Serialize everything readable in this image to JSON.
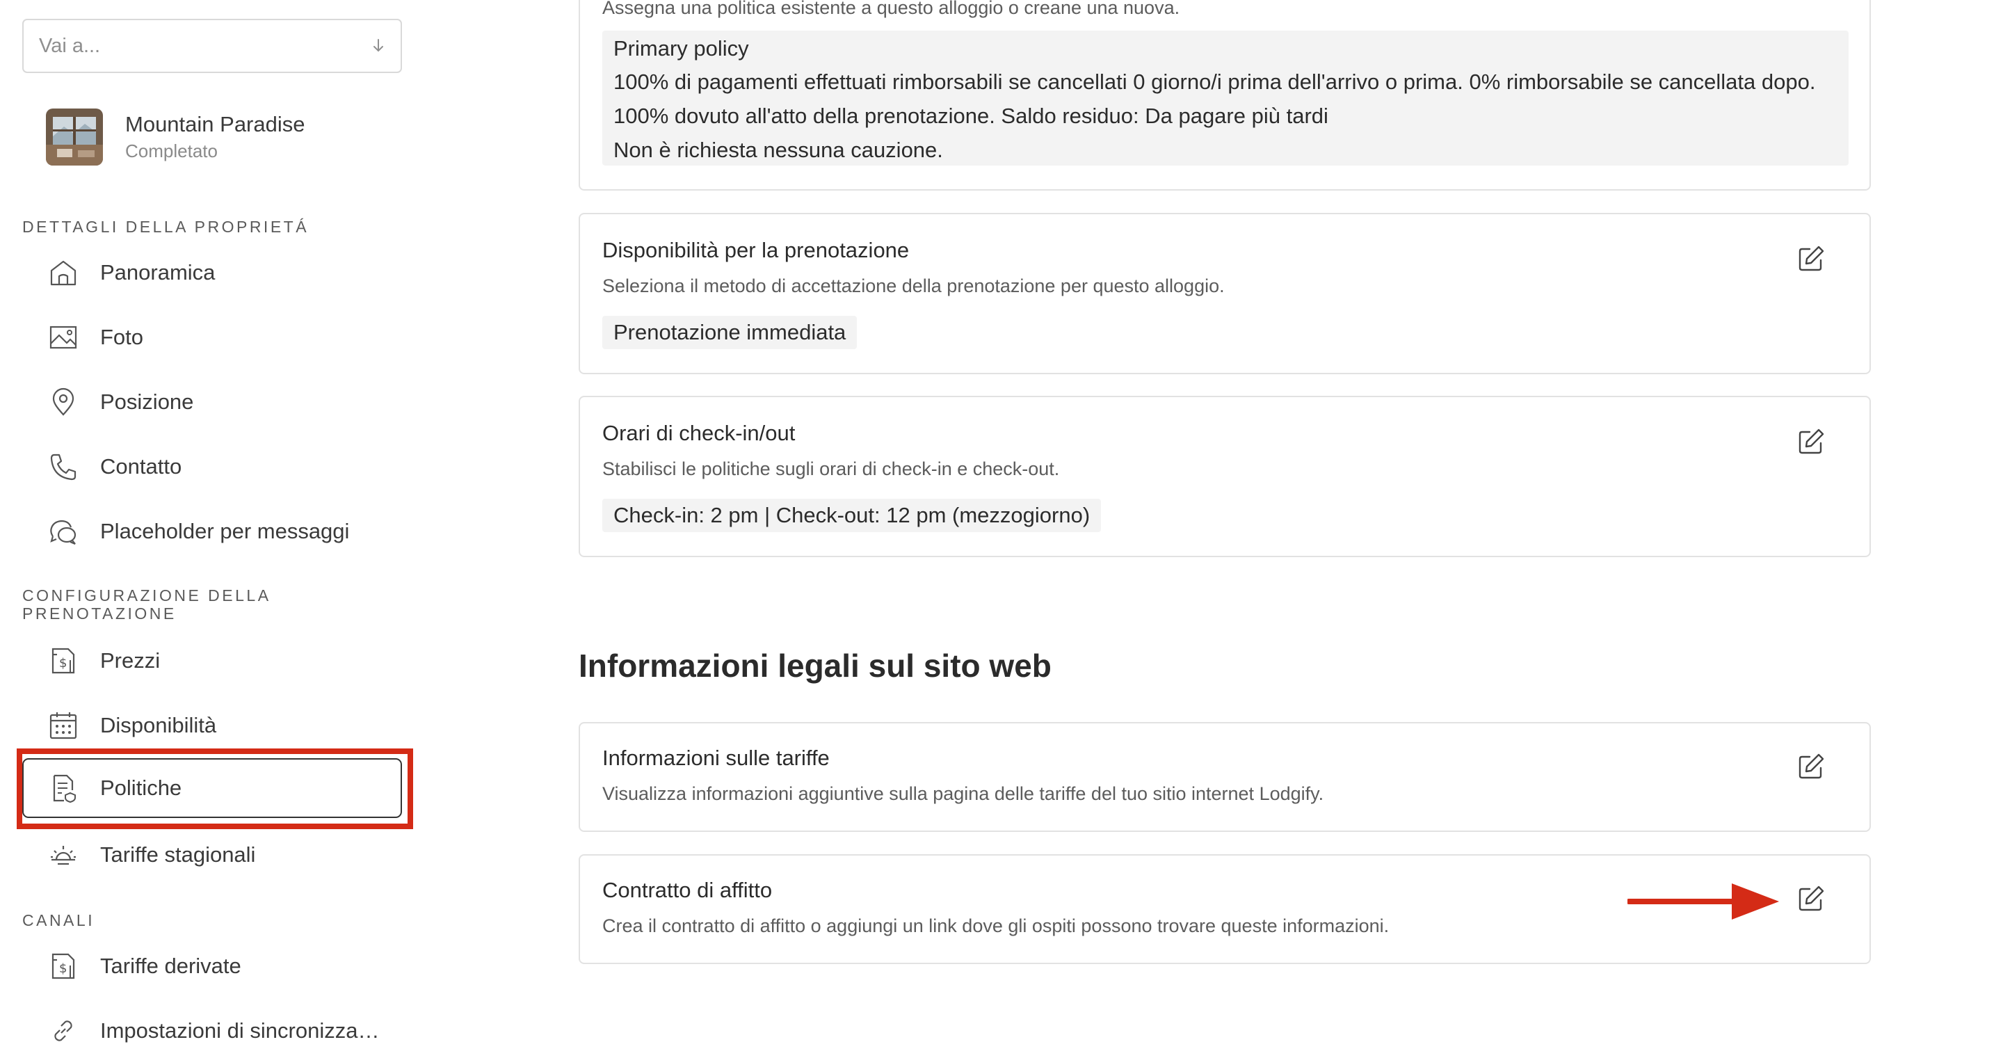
{
  "sidebar": {
    "goto": {
      "placeholder": "Vai a...",
      "icon": "arrow-down-icon"
    },
    "property": {
      "name": "Mountain Paradise",
      "status": "Completato"
    },
    "sections": [
      {
        "title": "DETTAGLI DELLA PROPRIETÁ",
        "items": [
          {
            "label": "Panoramica",
            "icon": "home-icon"
          },
          {
            "label": "Foto",
            "icon": "image-icon"
          },
          {
            "label": "Posizione",
            "icon": "location-pin-icon"
          },
          {
            "label": "Contatto",
            "icon": "phone-icon"
          },
          {
            "label": "Placeholder per messaggi",
            "icon": "chat-bubbles-icon"
          }
        ]
      },
      {
        "title": "CONFIGURAZIONE DELLA PRENOTAZIONE",
        "items": [
          {
            "label": "Prezzi",
            "icon": "price-tag-icon"
          },
          {
            "label": "Disponibilità",
            "icon": "calendar-icon"
          },
          {
            "label": "Politiche",
            "icon": "policy-document-icon",
            "active": true
          },
          {
            "label": "Tariffe stagionali",
            "icon": "sun-icon"
          }
        ]
      },
      {
        "title": "CANALI",
        "items": [
          {
            "label": "Tariffe derivate",
            "icon": "price-tag-icon"
          },
          {
            "label": "Impostazioni di sincronizza…",
            "icon": "link-icon"
          }
        ]
      }
    ]
  },
  "main": {
    "cancellation_card": {
      "intro": "Assegna una politica esistente a questo alloggio o creane una nuova.",
      "policy_lines": [
        "Primary policy",
        "100% di pagamenti effettuati rimborsabili se cancellati 0 giorno/i prima dell'arrivo o prima. 0% rimborsabile se cancellata dopo.",
        "100% dovuto all'atto della prenotazione. Saldo residuo: Da pagare più tardi",
        "Non è richiesta nessuna cauzione."
      ]
    },
    "booking_availability": {
      "title": "Disponibilità per la prenotazione",
      "description": "Seleziona il metodo di accettazione della prenotazione per questo alloggio.",
      "value": "Prenotazione immediata"
    },
    "checkin_times": {
      "title": "Orari di check-in/out",
      "description": "Stabilisci le politiche sugli orari di check-in e check-out.",
      "value": "Check-in: 2 pm | Check-out: 12 pm (mezzogiorno)"
    },
    "legal_heading": "Informazioni legali sul sito web",
    "rates_info": {
      "title": "Informazioni sulle tariffe",
      "description": "Visualizza informazioni aggiuntive sulla pagina delle tariffe del tuo sitio internet Lodgify."
    },
    "rental_contract": {
      "title": "Contratto di affitto",
      "description": "Crea il contratto di affitto o aggiungi un link dove gli ospiti possono trovare queste informazioni."
    }
  },
  "colors": {
    "highlight": "#d42b16",
    "arrow": "#d42b16"
  }
}
